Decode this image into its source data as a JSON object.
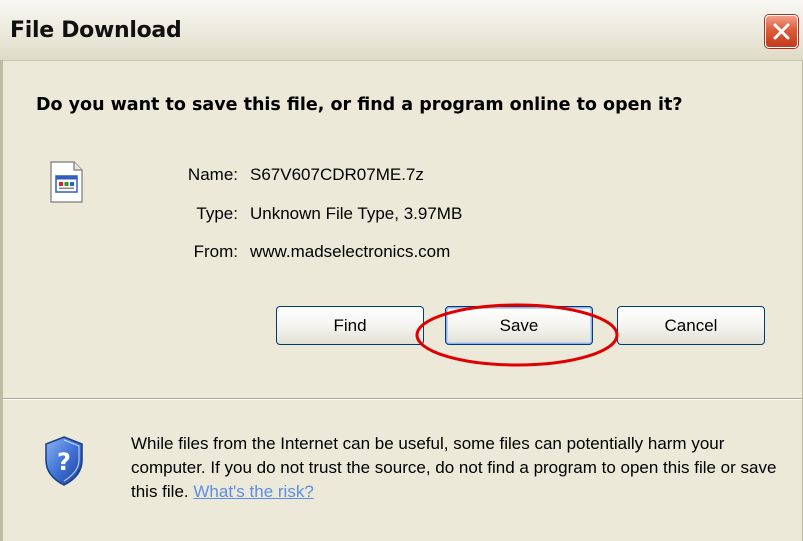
{
  "dialog": {
    "title": "File Download",
    "question": "Do you want to save this file, or find a program online to open it?",
    "file": {
      "name_label": "Name:",
      "name_value": "S67V607CDR07ME.7z",
      "type_label": "Type:",
      "type_value": "Unknown File Type, 3.97MB",
      "from_label": "From:",
      "from_value": "www.madselectronics.com",
      "icon": "unknown-file-icon"
    },
    "buttons": {
      "find": "Find",
      "save": "Save",
      "cancel": "Cancel"
    },
    "warning": {
      "text": "While files from the Internet can be useful, some files can potentially harm your computer. If you do not trust the source, do not find a program to open this file or save this file.",
      "link": "What's the risk?",
      "icon": "shield-question-icon"
    }
  },
  "colors": {
    "dialog_bg": "#ECE9D8",
    "button_border": "#003c74",
    "close_red": "#d4512f",
    "highlight_red": "#e00000",
    "link": "#5c8ee6"
  }
}
